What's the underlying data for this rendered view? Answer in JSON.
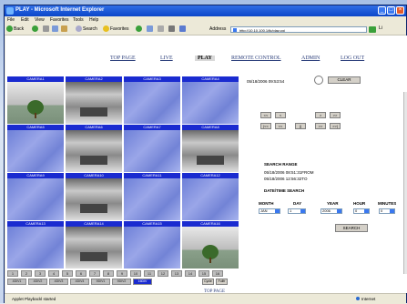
{
  "window": {
    "title": "PLAY - Microsoft Internet Explorer"
  },
  "menu": [
    "File",
    "Edit",
    "View",
    "Favorites",
    "Tools",
    "Help"
  ],
  "toolbar": {
    "back": "Back",
    "search": "Search",
    "favorites": "Favorites",
    "address_label": "Address",
    "address": "http://10.10.100.1/tk/play.cgi",
    "links": "Li"
  },
  "nav": {
    "top_page": "TOP PAGE",
    "live": "LIVE",
    "play": "PLAY",
    "remote_control": "REMOTE CONTROL",
    "admin": "ADMIN",
    "logout": "LOG OUT"
  },
  "cameras": [
    {
      "label": "CAMERA1",
      "kind": "ext"
    },
    {
      "label": "CAMERA2",
      "kind": "office"
    },
    {
      "label": "CAMERA3",
      "kind": "blue"
    },
    {
      "label": "CAMERA4",
      "kind": "blue"
    },
    {
      "label": "CAMERA5",
      "kind": "blue"
    },
    {
      "label": "CAMERA6",
      "kind": "office"
    },
    {
      "label": "CAMERA7",
      "kind": "blue"
    },
    {
      "label": "CAMERA8",
      "kind": "office"
    },
    {
      "label": "CAMERA9",
      "kind": "blue"
    },
    {
      "label": "CAMERA10",
      "kind": "office"
    },
    {
      "label": "CAMERA11",
      "kind": "blue"
    },
    {
      "label": "CAMERA12",
      "kind": "blue"
    },
    {
      "label": "CAMERA13",
      "kind": "blue"
    },
    {
      "label": "CAMERA14",
      "kind": "office"
    },
    {
      "label": "CAMERA15",
      "kind": "blue"
    },
    {
      "label": "CAMERA16",
      "kind": "ext"
    }
  ],
  "channel_buttons": [
    "1",
    "2",
    "3",
    "4",
    "5",
    "6",
    "7",
    "8",
    "9",
    "10",
    "11",
    "12",
    "13",
    "14",
    "15",
    "16"
  ],
  "view_buttons": [
    "4DIV1",
    "4DIV2",
    "4DIV3",
    "4DIV4",
    "9DIV1",
    "9DIV2",
    "16DIV"
  ],
  "active_view": 6,
  "extra_buttons": [
    "Cycle",
    "Fullfr"
  ],
  "bottom_link": "TOP PAGE",
  "right": {
    "datetime": "05/18/2006 09:53:54",
    "clear": "CLEAR",
    "ctrl_row1": [
      "<<",
      "<",
      ">",
      ">>"
    ],
    "ctrl_row2": [
      "|<<",
      "<<",
      "||",
      ">>",
      ">>|"
    ],
    "search_range": "SEARCH RANGE",
    "range_from": "05/18/2006 08:51:31FROM",
    "range_to": "05/18/2006 12:56:32TO",
    "dt_search": "DATE/TIME SEARCH",
    "fields": [
      "MONTH",
      "DAY",
      "YEAR",
      "HOUR",
      "MINUTES"
    ],
    "values": [
      "JAN",
      "1",
      "2006",
      "0",
      "0"
    ],
    "search": "SEARCH"
  },
  "status": {
    "text": "Applet Playbackl started",
    "zone": "Internet"
  }
}
